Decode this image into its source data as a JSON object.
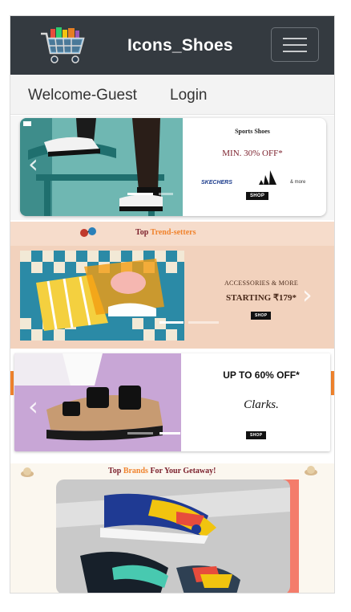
{
  "navbar": {
    "brand": "Icons_Shoes",
    "logo_icon": "shopping-cart-icon",
    "menu_icon": "hamburger-menu-icon",
    "background": "#343a40"
  },
  "userbar": {
    "welcome": "Welcome-Guest",
    "login": "Login"
  },
  "banners": [
    {
      "title": "Sports Shoes",
      "offer": "MIN. 30% OFF*",
      "brands": [
        "SKECHERS",
        "adidas"
      ],
      "more": "& more",
      "button": "SHOP"
    },
    {
      "heading_part1": "Top ",
      "heading_part2": "Trend-setters",
      "line1": "ACCESSORIES & MORE",
      "line2": "STARTING ₹179*",
      "button": "SHOP"
    },
    {
      "offer": "UP TO 60% OFF*",
      "brand": "Clarks.",
      "button": "SHOP"
    },
    {
      "heading_part1": "Top ",
      "heading_part2": "Brands",
      "heading_part3": " For Your Getaway!"
    }
  ],
  "carousel": {
    "prev_icon": "chevron-left-icon",
    "next_icon": "chevron-right-icon"
  },
  "colors": {
    "accent_orange": "#f0832d",
    "heading_red": "#c0392b",
    "peach": "#f2d2bd"
  }
}
